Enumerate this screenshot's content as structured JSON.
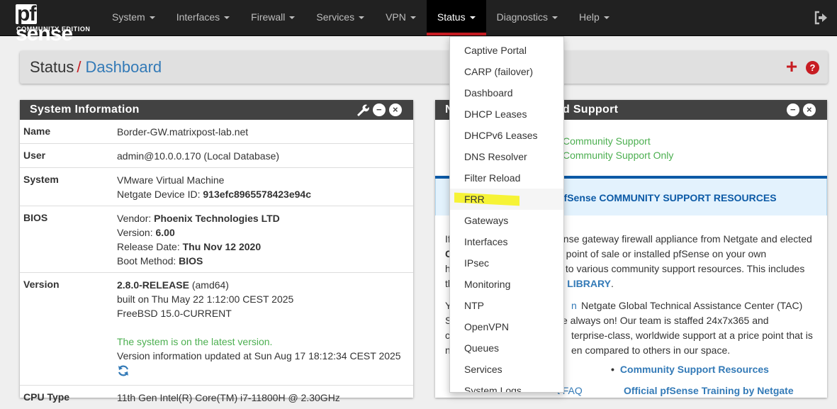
{
  "brand": {
    "logo_pf": "pf",
    "logo_sense": "sense",
    "edition": "COMMUNITY EDITION"
  },
  "nav": {
    "items": [
      {
        "label": "System"
      },
      {
        "label": "Interfaces"
      },
      {
        "label": "Firewall"
      },
      {
        "label": "Services"
      },
      {
        "label": "VPN"
      },
      {
        "label": "Status"
      },
      {
        "label": "Diagnostics"
      },
      {
        "label": "Help"
      }
    ],
    "active": "Status"
  },
  "breadcrumb": {
    "parent": "Status",
    "separator": "/",
    "current": "Dashboard"
  },
  "status_menu": {
    "items": [
      {
        "label": "Captive Portal"
      },
      {
        "label": "CARP (failover)"
      },
      {
        "label": "Dashboard"
      },
      {
        "label": "DHCP Leases"
      },
      {
        "label": "DHCPv6 Leases"
      },
      {
        "label": "DNS Resolver"
      },
      {
        "label": "Filter Reload"
      },
      {
        "label": "FRR"
      },
      {
        "label": "Gateways"
      },
      {
        "label": "Interfaces"
      },
      {
        "label": "IPsec"
      },
      {
        "label": "Monitoring"
      },
      {
        "label": "NTP"
      },
      {
        "label": "OpenVPN"
      },
      {
        "label": "Queues"
      },
      {
        "label": "Services"
      },
      {
        "label": "System Logs"
      }
    ],
    "highlighted": "FRR"
  },
  "system_info": {
    "title": "System Information",
    "name_label": "Name",
    "name_value": "Border-GW.matrixpost-lab.net",
    "user_label": "User",
    "user_value": "admin@10.0.0.170 (Local Database)",
    "system_label": "System",
    "system_value": "VMware Virtual Machine",
    "device_id_prefix": "Netgate Device ID: ",
    "device_id": "913efc8965578423e94c",
    "bios_label": "BIOS",
    "bios_vendor_prefix": "Vendor: ",
    "bios_vendor": "Phoenix Technologies LTD",
    "bios_version_prefix": "Version: ",
    "bios_version": "6.00",
    "bios_date_prefix": "Release Date: ",
    "bios_date": "Thu Nov 12 2020",
    "bios_boot_prefix": "Boot Method: ",
    "bios_boot": "BIOS",
    "version_label": "Version",
    "version_release": "2.8.0-RELEASE",
    "version_arch": " (amd64)",
    "version_built": "built on Thu May 22 1:12:00 CEST 2025",
    "version_os": "FreeBSD 15.0-CURRENT",
    "version_status": "The system is on the latest version.",
    "version_updated": "Version information updated at Sun Aug 17 18:12:34 CEST 2025",
    "cpu_label": "CPU Type",
    "cpu_value": "11th Gen Intel(R) Core(TM) i7-11800H @ 2.30GHz"
  },
  "netgate_panel": {
    "title_left": "N",
    "title_right": "d Support",
    "support_line1": "Community Support",
    "support_line2": "Community Support Only",
    "resources_heading": "ofSense COMMUNITY SUPPORT RESOURCES",
    "p1_l1_a": "If",
    "p1_l1_b": "ense gateway firewall appliance from Netgate and elected",
    "p1_l2_a": "C",
    "p1_l2_b": "e point of sale or installed pfSense on your own",
    "p1_l3_a": "h",
    "p1_l3_b": "s to various community support resources. This includes",
    "p1_l4_a": "th",
    "p1_l4_b": "E LIBRARY",
    "p1_l4_c": ".",
    "p2_l1_a": "Y",
    "p2_l1_b": "n",
    "p2_l1_c": "Netgate Global Technical Assistance Center (TAC)",
    "p2_l2_a": "S",
    "p2_l2_b": "e always on! Our team is staffed 24x7x365 and",
    "p2_l3_a": "c",
    "p2_l3_b": "terprise-class, worldwide support at a price point that is",
    "p2_l4_a": "n",
    "p2_l4_b": "en compared to others in our space.",
    "bullet1": "Community Support Resources",
    "bullet2_left": "t FAQ",
    "bullet2_right": "Official pfSense Training by Netgate"
  },
  "colors": {
    "navbar": "#212121",
    "accent_red": "#c71c22",
    "link_blue": "#337ab7",
    "panel_head": "#424242",
    "green": "#4caf50",
    "highlight": "#f6f336"
  }
}
